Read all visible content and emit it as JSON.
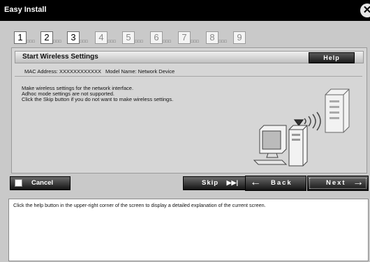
{
  "window": {
    "title": "Easy Install",
    "close_icon": "close-icon"
  },
  "steps": [
    {
      "number": "1",
      "active": true
    },
    {
      "number": "2",
      "active": true
    },
    {
      "number": "3",
      "active": true
    },
    {
      "number": "4",
      "active": false
    },
    {
      "number": "5",
      "active": false
    },
    {
      "number": "6",
      "active": false
    },
    {
      "number": "7",
      "active": false
    },
    {
      "number": "8",
      "active": false
    },
    {
      "number": "9",
      "active": false
    }
  ],
  "header": {
    "title": "Start Wireless Settings",
    "help_label": "Help"
  },
  "info": {
    "mac": "MAC Address: XXXXXXXXXXXX",
    "model": "Model Name: Network Device"
  },
  "description": [
    "Make wireless settings for the network interface.",
    "Adhoc mode settings are not supported.",
    "Click the Skip button if you do not want to make wireless settings."
  ],
  "buttons": {
    "cancel": "Cancel",
    "skip": "Skip",
    "back": "Back",
    "next": "Next"
  },
  "help_text": "Click the help button in the upper-right corner of the screen to display a detailed explanation of the current screen."
}
